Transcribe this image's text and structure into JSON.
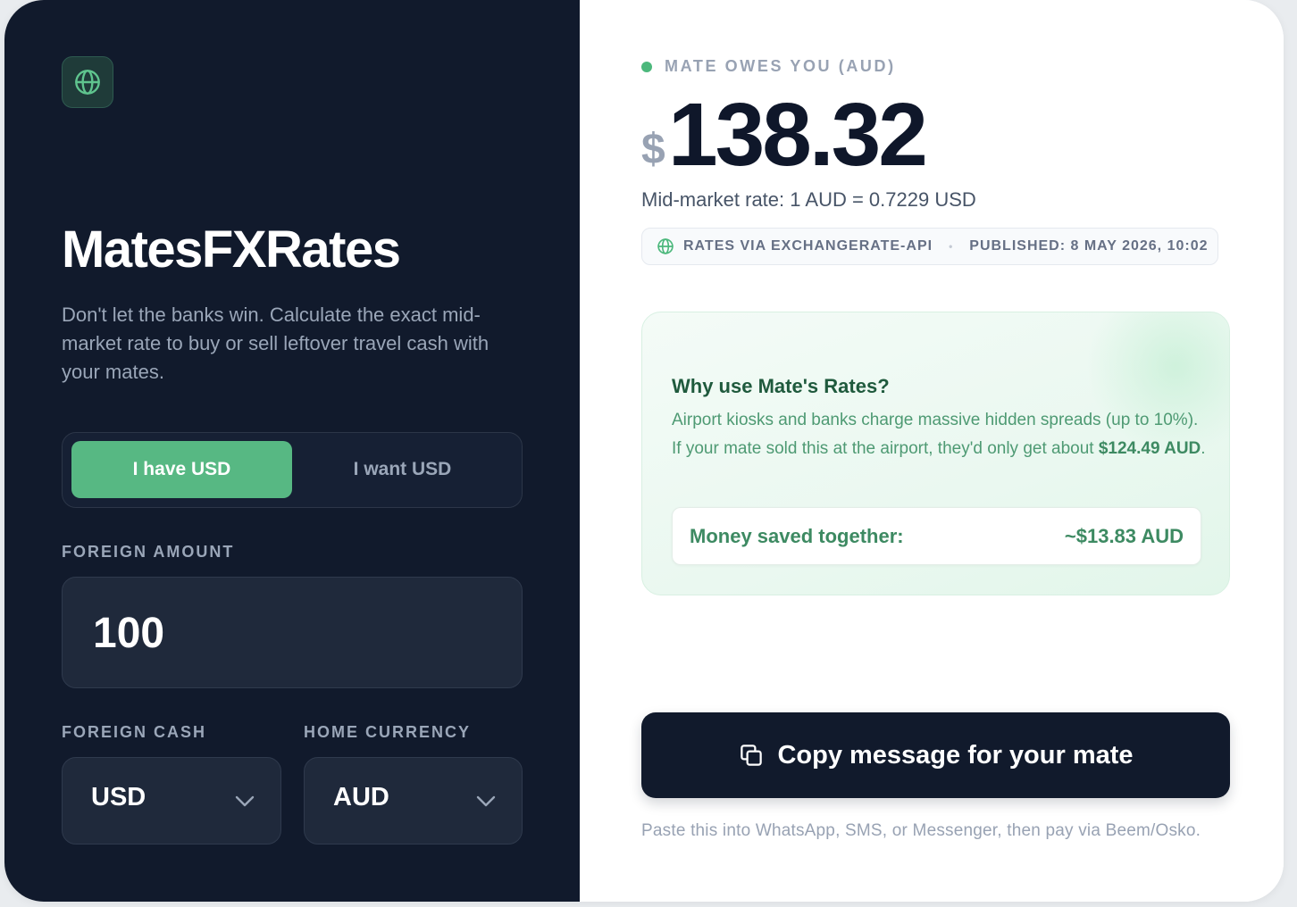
{
  "app": {
    "title": "MatesFXRates",
    "tagline": "Don't let the banks win. Calculate the exact mid-market rate to buy or sell leftover travel cash with your mates."
  },
  "toggle": {
    "have_label": "I have USD",
    "want_label": "I want USD",
    "active": "have"
  },
  "form": {
    "amount_label": "FOREIGN AMOUNT",
    "amount_value": "100",
    "foreign_cash_label": "FOREIGN CASH",
    "foreign_cash_value": "USD",
    "home_currency_label": "HOME CURRENCY",
    "home_currency_value": "AUD"
  },
  "result": {
    "owes_label": "MATE OWES YOU (AUD)",
    "currency_symbol": "$",
    "amount": "138.32",
    "rate_line": "Mid-market rate: 1 AUD = 0.7229 USD",
    "source": "RATES VIA EXCHANGERATE-API",
    "separator": "•",
    "published": "PUBLISHED: 8 MAY 2026, 10:02"
  },
  "why": {
    "title": "Why use Mate's Rates?",
    "body_prefix": "Airport kiosks and banks charge massive hidden spreads (up to 10%). If your mate sold this at the airport, they'd only get about ",
    "body_amount": "$124.49 AUD",
    "body_suffix": ".",
    "saved_label": "Money saved together:",
    "saved_value": "~$13.83 AUD"
  },
  "actions": {
    "copy_label": "Copy message for your mate",
    "footnote": "Paste this into WhatsApp, SMS, or Messenger, then pay via Beem/Osko."
  },
  "colors": {
    "dark_panel": "#111a2c",
    "accent_green": "#57b883",
    "text_dark": "#0f172a"
  },
  "icons": {
    "logo": "globe-icon",
    "source": "globe-icon",
    "select": "chevron-down-icon",
    "copy": "copy-icon"
  }
}
